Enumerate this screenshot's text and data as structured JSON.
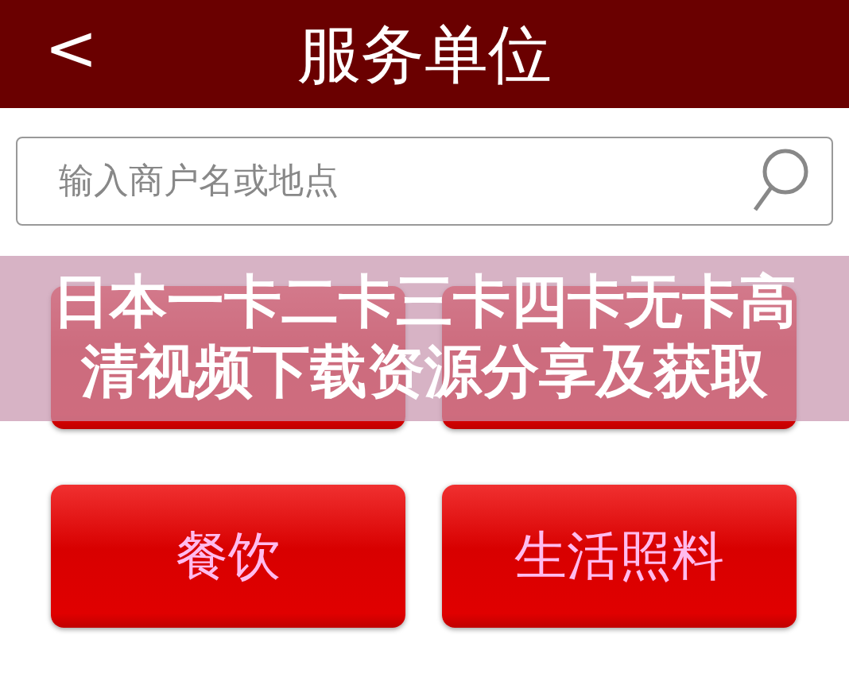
{
  "header": {
    "back": "<",
    "title": "服务单位"
  },
  "search": {
    "placeholder": "输入商户名或地点"
  },
  "buttons": [
    {
      "kind": "covered"
    },
    {
      "kind": "covered"
    },
    {
      "kind": "labeled",
      "label": "餐饮"
    },
    {
      "kind": "labeled",
      "label": "生活照料"
    }
  ],
  "banner": {
    "lines": [
      "日本一卡二卡三卡四卡无卡高",
      "清视频下载资源分享及获取"
    ]
  }
}
